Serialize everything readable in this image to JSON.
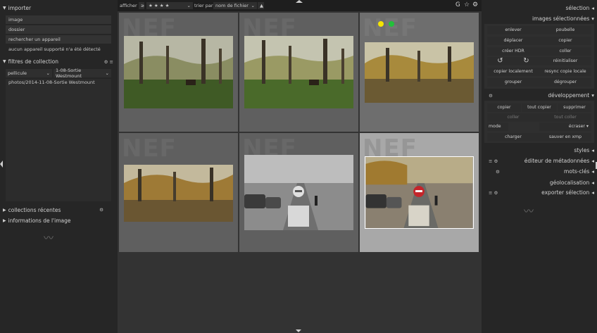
{
  "left": {
    "importer": {
      "title": "importer",
      "items": [
        "image",
        "dossier",
        "rechercher un appareil",
        "aucun appareil supporté n'a été détecté"
      ]
    },
    "collection_filters": {
      "title": "filtres de collection",
      "property": "pellicule",
      "value": "1-08-Sortie Westmount",
      "list": [
        "photos/2014-11-08-Sortie Westmount"
      ]
    },
    "recent": "collections récentes",
    "info": "informations de l'image"
  },
  "topbar": {
    "show_label": "afficher",
    "comparator": "≥",
    "stars": "★ ★ ★ ★",
    "sort_label": "trier par",
    "sort_value": "nom de fichier",
    "icons": [
      "G",
      "star-icon",
      "gear-icon"
    ]
  },
  "thumbnails": [
    {
      "id": "t1",
      "label": "NEF",
      "state": "normal",
      "style": "park-bench"
    },
    {
      "id": "t2",
      "label": "NEF",
      "state": "normal",
      "style": "park-bench"
    },
    {
      "id": "t3",
      "label": "NEF",
      "state": "hover",
      "style": "park-bright",
      "dots": [
        "#f4e400",
        "#22c13a"
      ]
    },
    {
      "id": "t4",
      "label": "NEF",
      "state": "normal",
      "style": "park-wide"
    },
    {
      "id": "t5",
      "label": "NEF",
      "state": "normal",
      "style": "street-bw"
    },
    {
      "id": "t6",
      "label": "NEF",
      "state": "selected",
      "style": "street-color"
    }
  ],
  "right": {
    "selection": "sélection",
    "selected_images": {
      "title": "images sélectionnées",
      "buttons": [
        "enlever",
        "poubelle",
        "déplacer",
        "copier",
        "créer HDR",
        "coller",
        "",
        "réinitialiser",
        "copier localement",
        "resync copie locale",
        "grouper",
        "dégrouper"
      ]
    },
    "development": {
      "title": "développement",
      "buttons": [
        "copier",
        "tout copier",
        "supprimer",
        "coller",
        "tout coller"
      ],
      "mode_label": "mode",
      "mode_value": "écraser",
      "load": "charger",
      "save": "sauver en xmp"
    },
    "styles": "styles",
    "metadata_editor": "éditeur de métadonnées",
    "tags": "mots-clés",
    "geolocation": "géolocalisation",
    "export": "exporter sélection"
  },
  "colors": {
    "panel": "#262626",
    "center": "#333333",
    "thumb": "#5f5f5f",
    "selected": "#a8a8a8"
  }
}
